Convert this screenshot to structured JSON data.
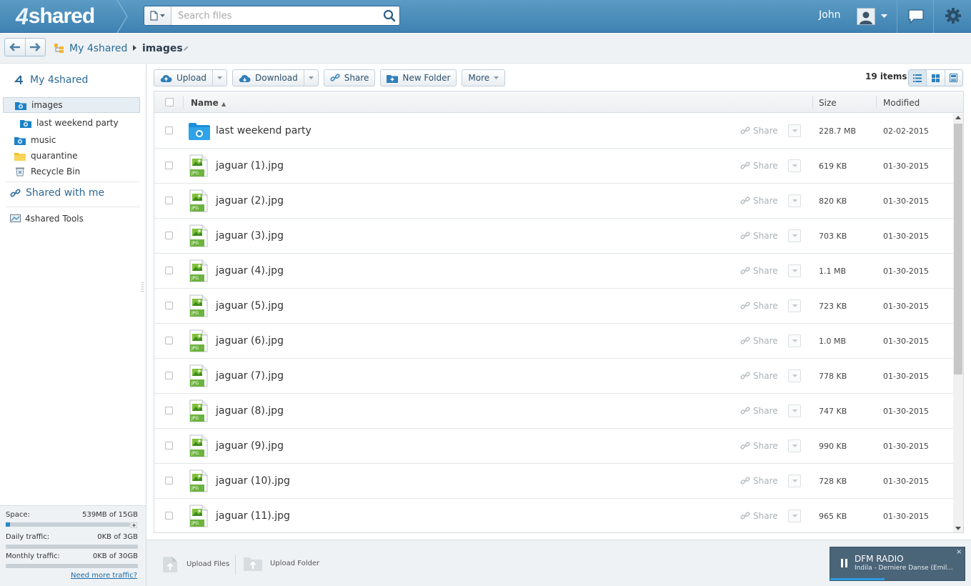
{
  "header": {
    "logo_text": "shared",
    "logo_num": "4",
    "search_placeholder": "Search files",
    "user_name": "John"
  },
  "breadcrumb": {
    "root": "My 4shared",
    "current": "images"
  },
  "sidebar": {
    "root_label": "My 4shared",
    "items": [
      {
        "label": "images"
      },
      {
        "label": "last weekend party"
      },
      {
        "label": "music"
      },
      {
        "label": "quarantine"
      },
      {
        "label": "Recycle Bin"
      }
    ],
    "shared_label": "Shared with me",
    "tools_label": "4shared Tools"
  },
  "quota": {
    "space_label": "Space:",
    "space_value": "539MB of 15GB",
    "space_fraction": 0.035,
    "daily_label": "Daily traffic:",
    "daily_value": "0KB of 3GB",
    "monthly_label": "Monthly traffic:",
    "monthly_value": "0KB of 30GB",
    "more_link": "Need more traffic?"
  },
  "toolbar": {
    "upload": "Upload",
    "download": "Download",
    "share": "Share",
    "new_folder": "New Folder",
    "more": "More",
    "items_count": "19 items"
  },
  "table": {
    "col_name": "Name",
    "col_size": "Size",
    "col_modified": "Modified",
    "share_label": "Share",
    "rows": [
      {
        "name": "last weekend party",
        "size": "228.7 MB",
        "modified": "02-02-2015",
        "type": "folder"
      },
      {
        "name": "jaguar (1).jpg",
        "size": "619 KB",
        "modified": "01-30-2015",
        "type": "jpg"
      },
      {
        "name": "jaguar (2).jpg",
        "size": "820 KB",
        "modified": "01-30-2015",
        "type": "jpg"
      },
      {
        "name": "jaguar (3).jpg",
        "size": "703 KB",
        "modified": "01-30-2015",
        "type": "jpg"
      },
      {
        "name": "jaguar (4).jpg",
        "size": "1.1 MB",
        "modified": "01-30-2015",
        "type": "jpg"
      },
      {
        "name": "jaguar (5).jpg",
        "size": "723 KB",
        "modified": "01-30-2015",
        "type": "jpg"
      },
      {
        "name": "jaguar (6).jpg",
        "size": "1.0 MB",
        "modified": "01-30-2015",
        "type": "jpg"
      },
      {
        "name": "jaguar (7).jpg",
        "size": "778 KB",
        "modified": "01-30-2015",
        "type": "jpg"
      },
      {
        "name": "jaguar (8).jpg",
        "size": "747 KB",
        "modified": "01-30-2015",
        "type": "jpg"
      },
      {
        "name": "jaguar (9).jpg",
        "size": "990 KB",
        "modified": "01-30-2015",
        "type": "jpg"
      },
      {
        "name": "jaguar (10).jpg",
        "size": "728 KB",
        "modified": "01-30-2015",
        "type": "jpg"
      },
      {
        "name": "jaguar (11).jpg",
        "size": "965 KB",
        "modified": "01-30-2015",
        "type": "jpg"
      }
    ],
    "jpg_badge": "JPG"
  },
  "bottom": {
    "upload_files": "Upload Files",
    "upload_folder": "Upload Folder"
  },
  "radio": {
    "title": "DFM RADIO",
    "track": "Indila - Derniere Danse (Emil...",
    "close": "×"
  }
}
